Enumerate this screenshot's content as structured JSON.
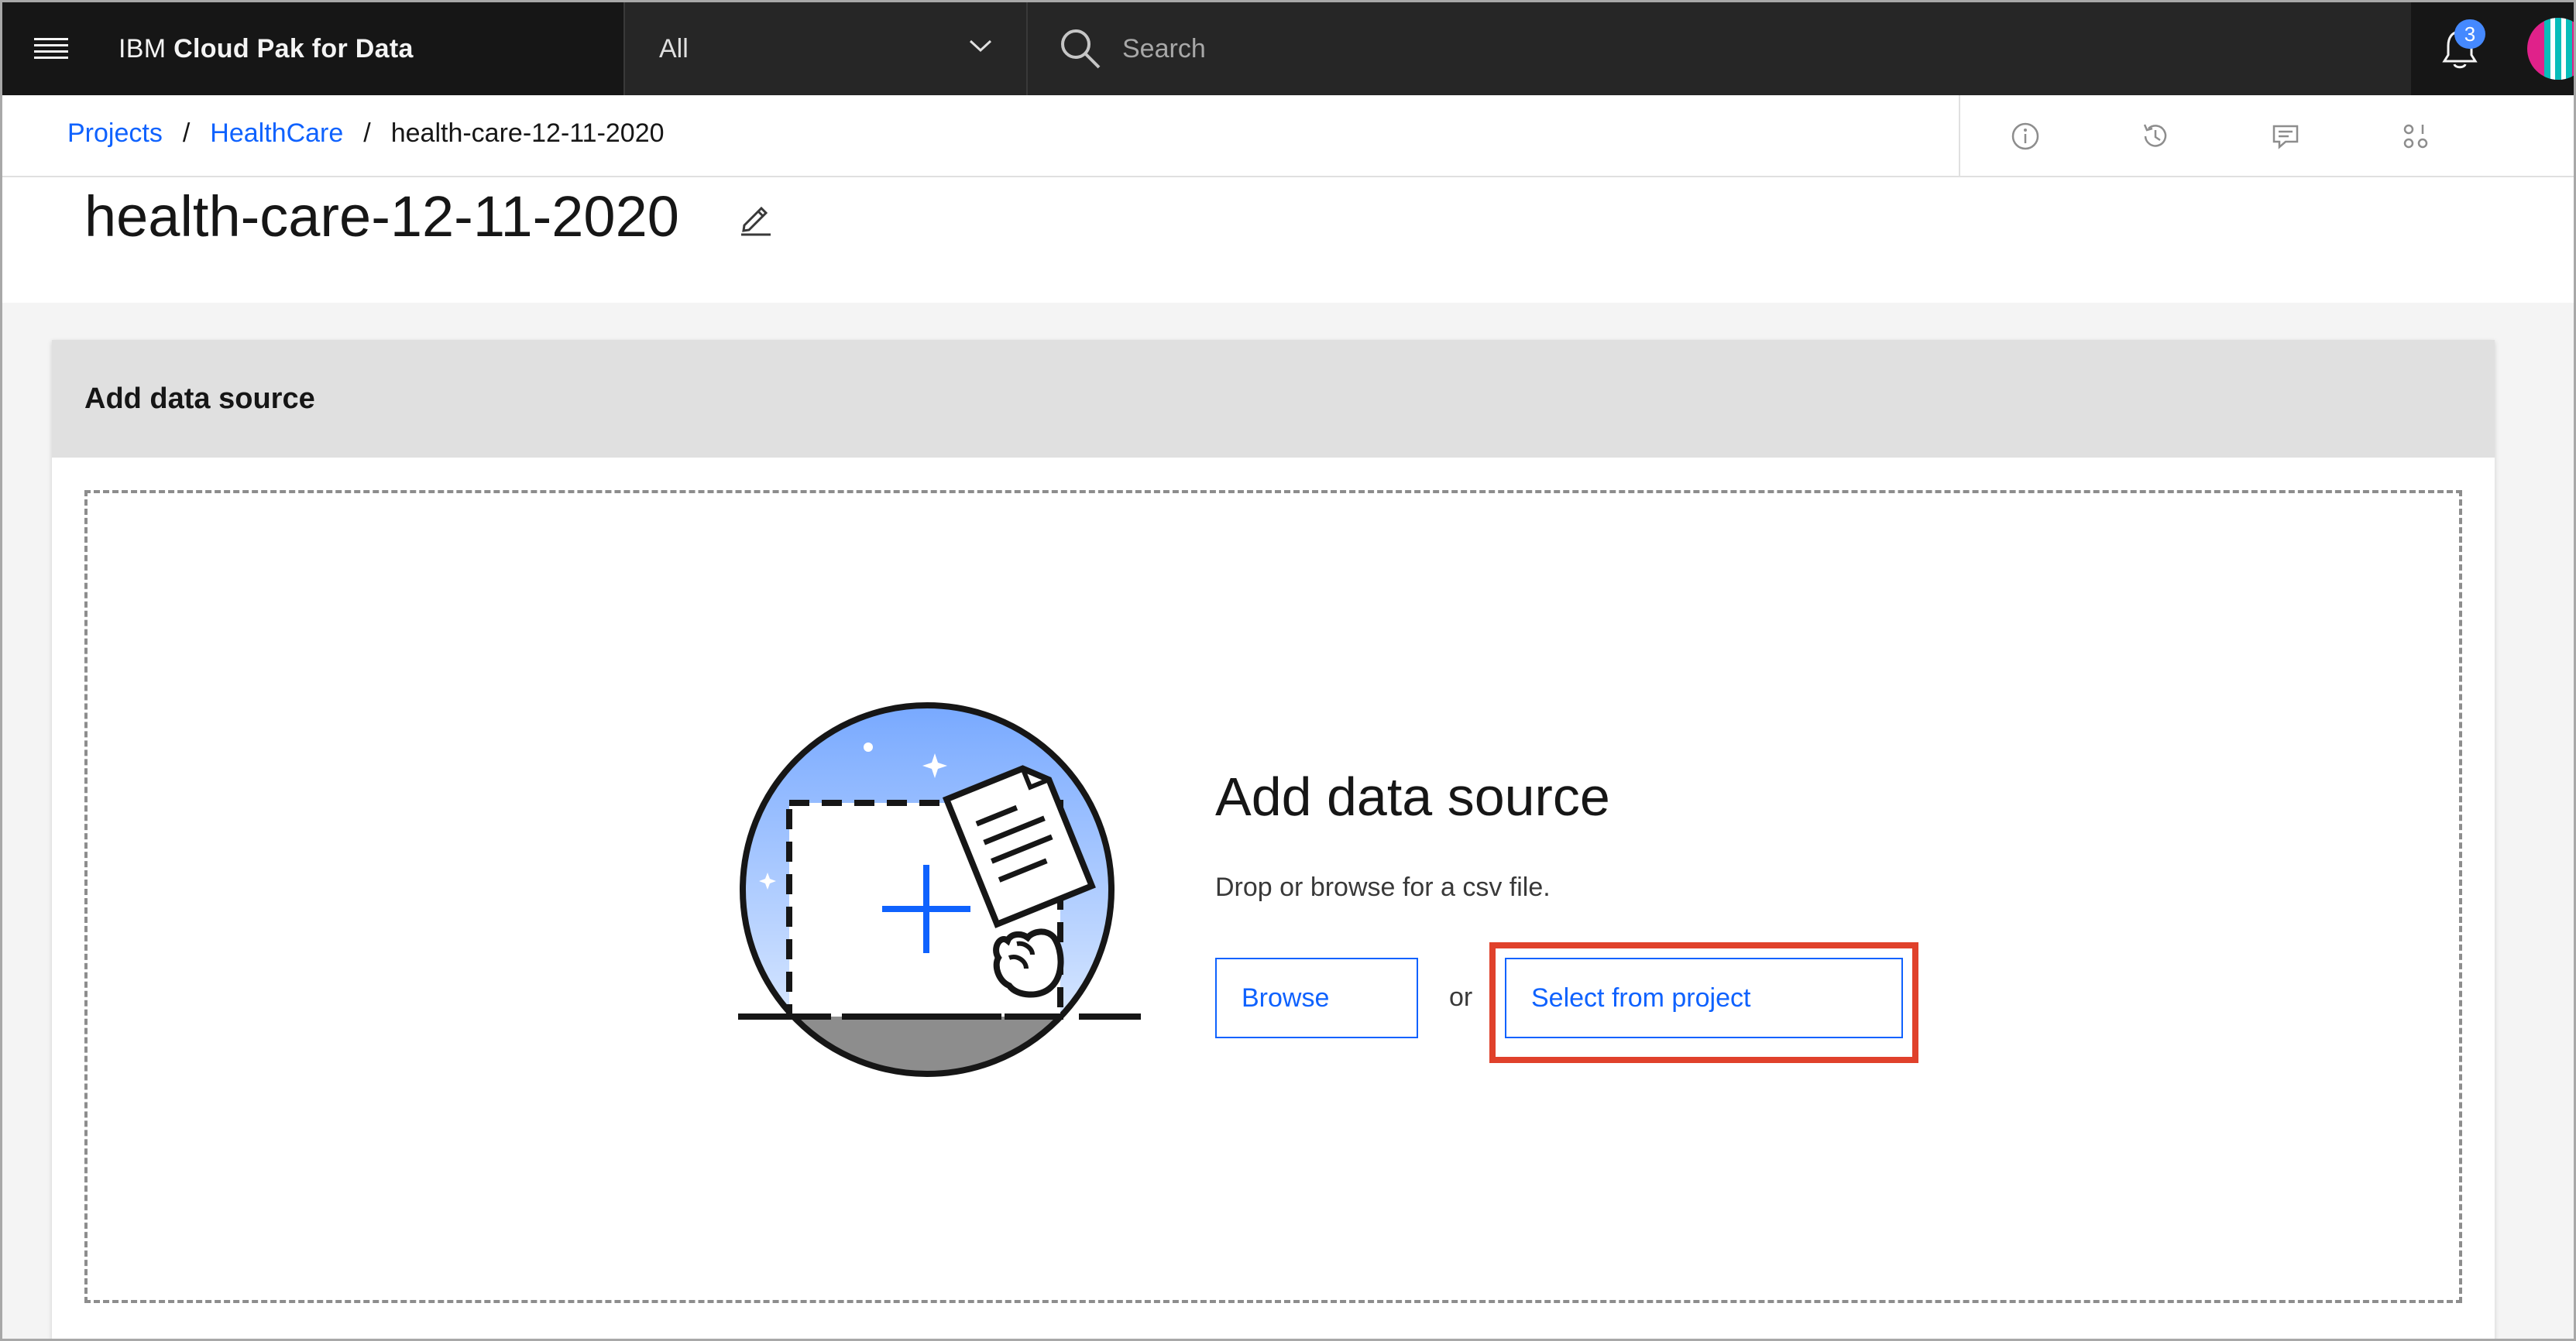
{
  "header": {
    "brand_prefix": "IBM",
    "brand_name": "Cloud Pak for Data",
    "scope_selected": "All",
    "search_placeholder": "Search",
    "notification_count": "3"
  },
  "breadcrumb": {
    "items": [
      {
        "label": "Projects"
      },
      {
        "label": "HealthCare"
      }
    ],
    "current": "health-care-12-11-2020",
    "separator": "/"
  },
  "page": {
    "title": "health-care-12-11-2020"
  },
  "card": {
    "title": "Add data source"
  },
  "dropzone": {
    "title": "Add data source",
    "description": "Drop or browse for a csv file.",
    "browse_label": "Browse",
    "or_label": "or",
    "select_label": "Select from project"
  },
  "colors": {
    "accent": "#0f62fe",
    "header_bg": "#161616",
    "highlight": "#e0412b",
    "badge": "#4589ff"
  },
  "icons": {
    "menu": "hamburger-menu-icon",
    "search": "search-icon",
    "notification": "bell-icon",
    "info": "info-icon",
    "history": "history-icon",
    "comments": "comments-icon",
    "manage": "manage-icon",
    "edit": "edit-pencil-icon"
  }
}
